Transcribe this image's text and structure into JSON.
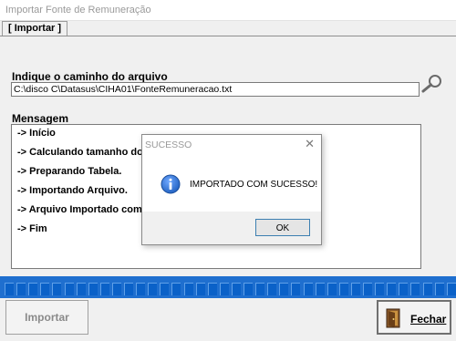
{
  "window": {
    "title": "Importar Fonte de Remuneração"
  },
  "tabs": [
    {
      "label": "[ Importar ]"
    }
  ],
  "path": {
    "label": "Indique o caminho do arquivo",
    "value": "C:\\disco C\\Datasus\\CIHA01\\FonteRemuneracao.txt"
  },
  "messages": {
    "label": "Mensagem",
    "lines": [
      "-> Início",
      "-> Calculando tamanho do",
      "-> Preparando Tabela.",
      "-> Importando Arquivo.",
      "-> Arquivo Importado com",
      "-> Fim"
    ]
  },
  "progress": {
    "value": 1.0,
    "segments": 38
  },
  "buttons": {
    "import": "Importar",
    "close": "Fechar"
  },
  "dialog": {
    "title": "SUCESSO",
    "message": "IMPORTADO COM SUCESSO!",
    "ok": "OK"
  },
  "icons": [
    "magnifier-icon",
    "info-icon",
    "close-icon",
    "door-exit-icon"
  ],
  "colors": {
    "progress": "#1f6fcf",
    "info": "#1f5fbf"
  }
}
